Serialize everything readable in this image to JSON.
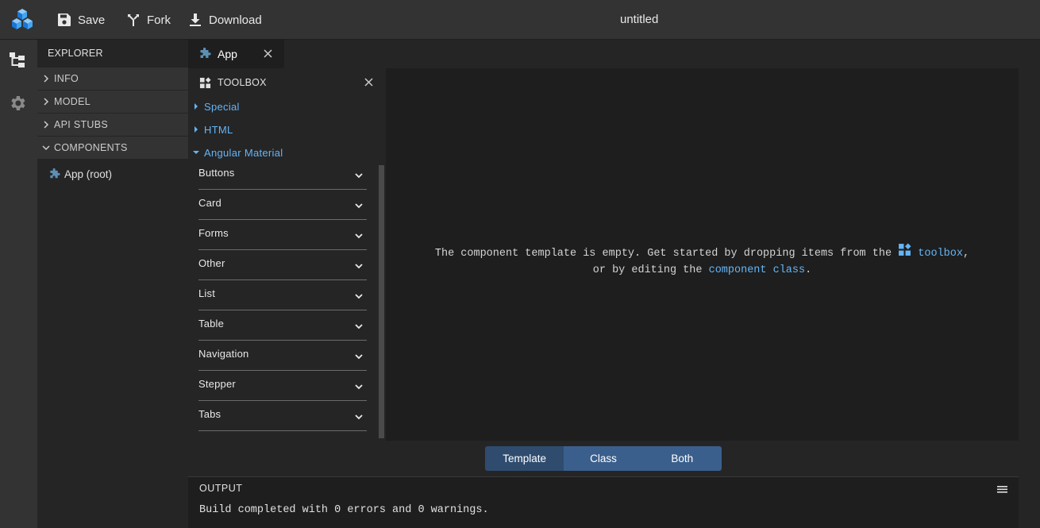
{
  "topbar": {
    "logo": "cubes-logo",
    "save_label": "Save",
    "fork_label": "Fork",
    "download_label": "Download",
    "title": "untitled"
  },
  "activity": {
    "items": [
      "component-tree-icon",
      "gear-icon"
    ]
  },
  "explorer": {
    "header": "EXPLORER",
    "sections": [
      {
        "label": "INFO",
        "expanded": false
      },
      {
        "label": "MODEL",
        "expanded": false
      },
      {
        "label": "API STUBS",
        "expanded": false
      },
      {
        "label": "COMPONENTS",
        "expanded": true
      }
    ],
    "components": [
      {
        "label": "App (root)",
        "icon": "puzzle-icon"
      }
    ]
  },
  "editor": {
    "tab_label": "App",
    "tab_icon": "puzzle-icon"
  },
  "toolbox": {
    "header": "TOOLBOX",
    "categories": [
      {
        "label": "Special",
        "expanded": false
      },
      {
        "label": "HTML",
        "expanded": false
      },
      {
        "label": "Angular Material",
        "expanded": true
      }
    ],
    "items": [
      {
        "label": "Buttons"
      },
      {
        "label": "Card"
      },
      {
        "label": "Forms"
      },
      {
        "label": "Other"
      },
      {
        "label": "List"
      },
      {
        "label": "Table"
      },
      {
        "label": "Navigation"
      },
      {
        "label": "Stepper"
      },
      {
        "label": "Tabs"
      }
    ]
  },
  "canvas": {
    "msg_part1": "The component template is empty. Get started by dropping items from the ",
    "toolbox_link": "toolbox",
    "msg_part2": ",",
    "msg_part3": "or by editing the ",
    "class_link": "component class",
    "msg_part4": "."
  },
  "view_switch": {
    "options": [
      "Template",
      "Class",
      "Both"
    ],
    "active": "Template"
  },
  "output": {
    "header": "OUTPUT",
    "text": "Build completed with 0 errors and 0 warnings."
  },
  "colors": {
    "accent": "#64b5f6",
    "switch_active": "#2f4c6f",
    "switch_inactive": "#3b5f8c",
    "editor_bg": "#1e1e1e",
    "panel_bg": "#252526"
  }
}
